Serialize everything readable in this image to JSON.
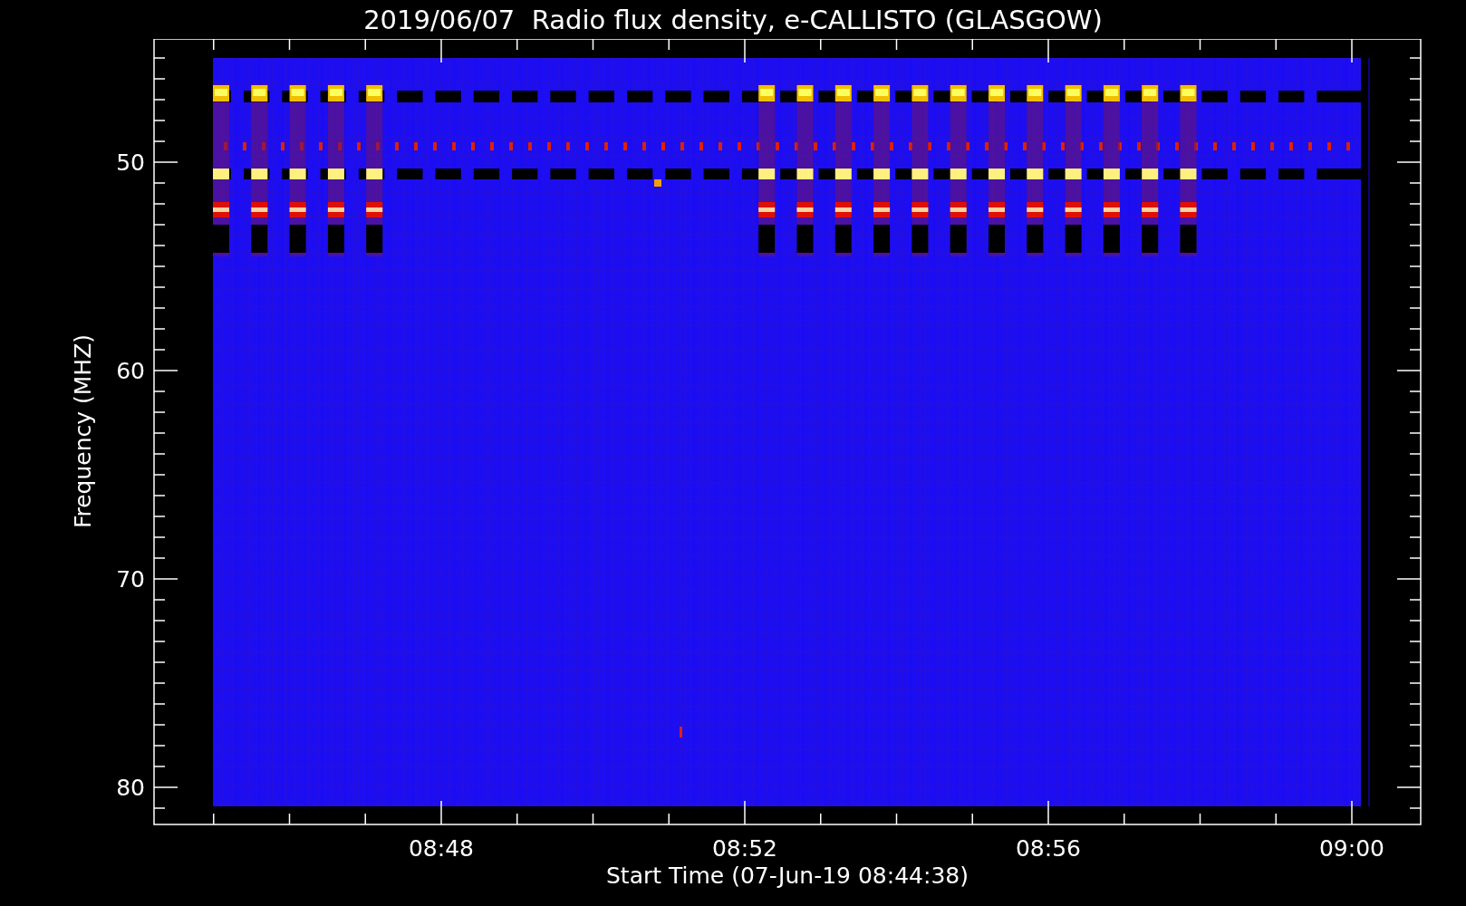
{
  "title": "2019/06/07  Radio flux density, e-CALLISTO (GLASGOW)",
  "plot": {
    "ylabel": "Frequency (MHZ)",
    "xlabel": "Start Time (07-Jun-19 08:44:38)",
    "yticks": [
      "50",
      "60",
      "70",
      "80"
    ],
    "xticks": [
      "08:48",
      "08:52",
      "08:56",
      "09:00"
    ]
  }
}
